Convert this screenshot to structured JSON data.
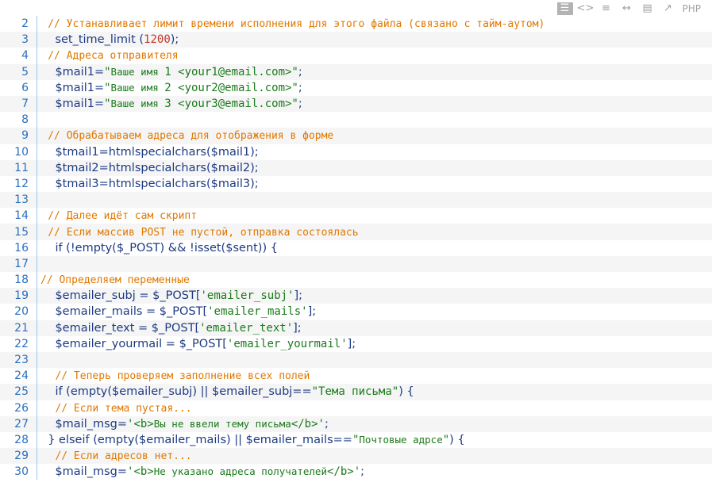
{
  "toolbar": {
    "icons": [
      "view-source-icon",
      "code-icon",
      "wrap-icon",
      "expand-icon",
      "copy-icon",
      "popup-icon"
    ],
    "language": "PHP"
  },
  "lines": [
    {
      "n": "2",
      "alt": false,
      "indent": "  ",
      "parts": [
        [
          "cm",
          "// Устанавливает лимит времени исполнения для этого файла (связано с тайм-аутом)"
        ]
      ]
    },
    {
      "n": "3",
      "alt": true,
      "indent": "    ",
      "parts": [
        [
          "txt",
          "set_time_limit ("
        ],
        [
          "nm",
          "1200"
        ],
        [
          "txt",
          ");"
        ]
      ]
    },
    {
      "n": "4",
      "alt": false,
      "indent": "  ",
      "parts": [
        [
          "cm",
          "// Адреса отправителя"
        ]
      ]
    },
    {
      "n": "5",
      "alt": true,
      "indent": "    ",
      "parts": [
        [
          "txt",
          "$mail1="
        ],
        [
          "st",
          "\""
        ],
        [
          "st-small",
          "Ваше имя "
        ],
        [
          "st",
          "1 <your1@email.com>\""
        ],
        [
          "txt",
          ";"
        ]
      ]
    },
    {
      "n": "6",
      "alt": false,
      "indent": "    ",
      "parts": [
        [
          "txt",
          "$mail1="
        ],
        [
          "st",
          "\""
        ],
        [
          "st-small",
          "Ваше имя "
        ],
        [
          "st",
          "2 <your2@email.com>\""
        ],
        [
          "txt",
          ";"
        ]
      ]
    },
    {
      "n": "7",
      "alt": true,
      "indent": "    ",
      "parts": [
        [
          "txt",
          "$mail1="
        ],
        [
          "st",
          "\""
        ],
        [
          "st-small",
          "Ваше имя "
        ],
        [
          "st",
          "3 <your3@email.com>\""
        ],
        [
          "txt",
          ";"
        ]
      ]
    },
    {
      "n": "8",
      "alt": false,
      "indent": "",
      "parts": []
    },
    {
      "n": "9",
      "alt": true,
      "indent": "  ",
      "parts": [
        [
          "cm",
          "// Обрабатываем адреса для отображения в форме"
        ]
      ]
    },
    {
      "n": "10",
      "alt": false,
      "indent": "    ",
      "parts": [
        [
          "txt",
          "$tmail1=htmlspecialchars($mail1);"
        ]
      ]
    },
    {
      "n": "11",
      "alt": true,
      "indent": "    ",
      "parts": [
        [
          "txt",
          "$tmail2=htmlspecialchars($mail2);"
        ]
      ]
    },
    {
      "n": "12",
      "alt": false,
      "indent": "    ",
      "parts": [
        [
          "txt",
          "$tmail3=htmlspecialchars($mail3);"
        ]
      ]
    },
    {
      "n": "13",
      "alt": true,
      "indent": "",
      "parts": []
    },
    {
      "n": "14",
      "alt": false,
      "indent": "  ",
      "parts": [
        [
          "cm",
          "// Далее идёт сам скрипт"
        ]
      ]
    },
    {
      "n": "15",
      "alt": true,
      "indent": "  ",
      "parts": [
        [
          "cm",
          "// Если массив POST не пустой, отправка состоялась"
        ]
      ]
    },
    {
      "n": "16",
      "alt": false,
      "indent": "    ",
      "parts": [
        [
          "txt",
          "if (!empty($_POST) && !isset($sent)) {"
        ]
      ]
    },
    {
      "n": "17",
      "alt": true,
      "indent": "",
      "parts": []
    },
    {
      "n": "18",
      "alt": false,
      "indent": "",
      "parts": [
        [
          "cm",
          "// Определяем переменные"
        ]
      ]
    },
    {
      "n": "19",
      "alt": true,
      "indent": "    ",
      "parts": [
        [
          "txt",
          "$emailer_subj = $_POST["
        ],
        [
          "st",
          "'emailer_subj'"
        ],
        [
          "txt",
          "];"
        ]
      ]
    },
    {
      "n": "20",
      "alt": false,
      "indent": "    ",
      "parts": [
        [
          "txt",
          "$emailer_mails = $_POST["
        ],
        [
          "st",
          "'emailer_mails'"
        ],
        [
          "txt",
          "];"
        ]
      ]
    },
    {
      "n": "21",
      "alt": true,
      "indent": "    ",
      "parts": [
        [
          "txt",
          "$emailer_text = $_POST["
        ],
        [
          "st",
          "'emailer_text'"
        ],
        [
          "txt",
          "];"
        ]
      ]
    },
    {
      "n": "22",
      "alt": false,
      "indent": "    ",
      "parts": [
        [
          "txt",
          "$emailer_yourmail = $_POST["
        ],
        [
          "st",
          "'emailer_yourmail'"
        ],
        [
          "txt",
          "];"
        ]
      ]
    },
    {
      "n": "23",
      "alt": true,
      "indent": "",
      "parts": []
    },
    {
      "n": "24",
      "alt": false,
      "indent": "    ",
      "parts": [
        [
          "cm",
          "// Теперь проверяем заполнение всех полей"
        ]
      ]
    },
    {
      "n": "25",
      "alt": true,
      "indent": "    ",
      "parts": [
        [
          "txt",
          "if (empty($emailer_subj) || $emailer_subj=="
        ],
        [
          "st",
          "\"Тема письма\""
        ],
        [
          "txt",
          ") {"
        ]
      ]
    },
    {
      "n": "26",
      "alt": false,
      "indent": "    ",
      "parts": [
        [
          "cm",
          "// Если тема пустая..."
        ]
      ]
    },
    {
      "n": "27",
      "alt": true,
      "indent": "    ",
      "parts": [
        [
          "txt",
          "$mail_msg="
        ],
        [
          "st",
          "'<b>"
        ],
        [
          "st-small",
          "Вы не ввели тему письма"
        ],
        [
          "st",
          "</b>'"
        ],
        [
          "txt",
          ";"
        ]
      ]
    },
    {
      "n": "28",
      "alt": false,
      "indent": "  ",
      "parts": [
        [
          "txt",
          "} elseif (empty($emailer_mails) || $emailer_mails=="
        ],
        [
          "st",
          "\""
        ],
        [
          "st-small",
          "Почтовые адрсе"
        ],
        [
          "st",
          "\""
        ],
        [
          "txt",
          ") {"
        ]
      ]
    },
    {
      "n": "29",
      "alt": true,
      "indent": "    ",
      "parts": [
        [
          "cm",
          "// Если адресов нет..."
        ]
      ]
    },
    {
      "n": "30",
      "alt": false,
      "indent": "    ",
      "parts": [
        [
          "txt",
          "$mail_msg="
        ],
        [
          "st",
          "'<b>"
        ],
        [
          "st-small",
          "Не указано адреса получателей"
        ],
        [
          "st",
          "</b>'"
        ],
        [
          "txt",
          ";"
        ]
      ]
    }
  ]
}
